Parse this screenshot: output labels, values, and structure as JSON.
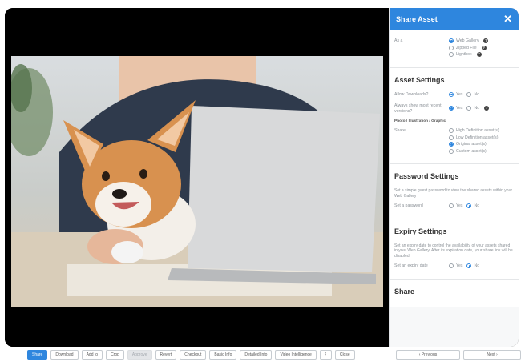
{
  "panel": {
    "title": "Share  Asset",
    "close": "✕",
    "as_a": {
      "label": "As a",
      "options": [
        "Web Gallery",
        "Zipped File",
        "Lightbox"
      ],
      "selected": 0
    },
    "asset_settings": {
      "title": "Asset Settings",
      "allow_downloads": {
        "label": "Allow Downloads?",
        "yes": "Yes",
        "no": "No"
      },
      "show_most_recent": {
        "label": "Always show most recent versions?",
        "yes": "Yes",
        "no": "No"
      },
      "subheading": "Photo / Illustration / Graphic",
      "share": {
        "label": "Share",
        "options": [
          "High Definition asset(s)",
          "Low Definition asset(s)",
          "Original asset(s)",
          "Custom asset(s)"
        ],
        "selected": 2
      }
    },
    "password_settings": {
      "title": "Password Settings",
      "description": "Set a simple guest password to view the shared assets within your Web Gallery",
      "set_password": {
        "label": "Set a password",
        "yes": "Yes",
        "no": "No"
      }
    },
    "expiry_settings": {
      "title": "Expiry Settings",
      "description": "Set an expiry date to control the availability of your assets shared in your Web Gallery. After its expiration date, your share link will be disabled.",
      "set_expiry": {
        "label": "Set an expiry date",
        "yes": "Yes",
        "no": "No"
      }
    },
    "share_section": {
      "title": "Share"
    }
  },
  "toolbar": {
    "buttons": [
      "Share",
      "Download",
      "Add to",
      "Crop",
      "Approve",
      "Revert",
      "Checkout",
      "Basic Info",
      "Detailed Info",
      "Video Intelligence",
      "⋮",
      "Close"
    ]
  },
  "nav": {
    "previous": "‹ Previous",
    "next": "Next ›"
  },
  "colors": {
    "accent": "#2e86de",
    "viewer_bg": "#000000"
  }
}
